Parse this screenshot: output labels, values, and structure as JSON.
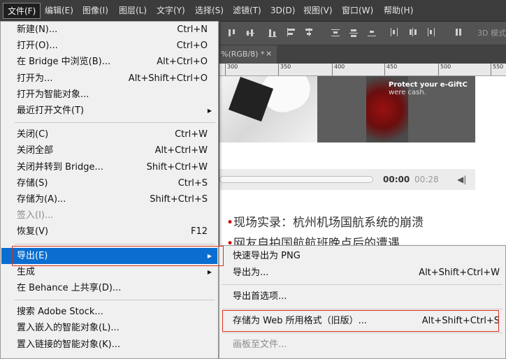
{
  "menubar": {
    "items": [
      "文件(F)",
      "编辑(E)",
      "图像(I)",
      "图层(L)",
      "文字(Y)",
      "选择(S)",
      "滤镜(T)",
      "3D(D)",
      "视图(V)",
      "窗口(W)",
      "帮助(H)"
    ]
  },
  "options_bar": {
    "mode_3d": "3D 模式"
  },
  "document": {
    "tab_title": "%(RGB/8) *",
    "close": "×",
    "ruler_ticks": [
      "300",
      "350",
      "400",
      "450",
      "500",
      "550"
    ]
  },
  "canvas": {
    "promo_line1": "Protect your e-GiftC",
    "promo_line2": "were cash.",
    "time_current": "00:00",
    "time_total": "00:28",
    "volume_icon": "◀|",
    "news1": "现场实录：杭州机场国航系统的崩溃",
    "news2": "网友自拍国航航班晚点后的遭遇",
    "bullet": "•"
  },
  "file_menu": {
    "groups": [
      [
        {
          "label": "新建(N)...",
          "shortcut": "Ctrl+N"
        },
        {
          "label": "打开(O)...",
          "shortcut": "Ctrl+O"
        },
        {
          "label": "在 Bridge 中浏览(B)...",
          "shortcut": "Alt+Ctrl+O"
        },
        {
          "label": "打开为...",
          "shortcut": "Alt+Shift+Ctrl+O"
        },
        {
          "label": "打开为智能对象...",
          "shortcut": ""
        },
        {
          "label": "最近打开文件(T)",
          "shortcut": "",
          "submenu": true
        }
      ],
      [
        {
          "label": "关闭(C)",
          "shortcut": "Ctrl+W"
        },
        {
          "label": "关闭全部",
          "shortcut": "Alt+Ctrl+W"
        },
        {
          "label": "关闭并转到 Bridge...",
          "shortcut": "Shift+Ctrl+W"
        },
        {
          "label": "存储(S)",
          "shortcut": "Ctrl+S"
        },
        {
          "label": "存储为(A)...",
          "shortcut": "Shift+Ctrl+S"
        },
        {
          "label": "签入(I)...",
          "shortcut": "",
          "disabled": true
        },
        {
          "label": "恢复(V)",
          "shortcut": "F12"
        }
      ],
      [
        {
          "label": "导出(E)",
          "shortcut": "",
          "submenu": true,
          "highlighted": true
        },
        {
          "label": "生成",
          "shortcut": "",
          "submenu": true
        },
        {
          "label": "在 Behance 上共享(D)...",
          "shortcut": ""
        }
      ],
      [
        {
          "label": "搜索 Adobe Stock...",
          "shortcut": ""
        },
        {
          "label": "置入嵌入的智能对象(L)...",
          "shortcut": ""
        },
        {
          "label": "置入链接的智能对象(K)...",
          "shortcut": ""
        }
      ]
    ]
  },
  "export_submenu": {
    "groups": [
      [
        {
          "label": "快速导出为 PNG",
          "shortcut": ""
        },
        {
          "label": "导出为...",
          "shortcut": "Alt+Shift+Ctrl+W"
        }
      ],
      [
        {
          "label": "导出首选项...",
          "shortcut": ""
        }
      ],
      [
        {
          "label": "存储为 Web 所用格式（旧版）...",
          "shortcut": "Alt+Shift+Ctrl+S"
        }
      ],
      [
        {
          "label": "画板至文件...",
          "shortcut": "",
          "disabled": true
        }
      ]
    ]
  },
  "colors": {
    "menu_bg": "#f0f0f0",
    "highlight": "#0a6ed1",
    "annotation_red": "#e0301e",
    "menubar_bg": "#3c3c3c"
  }
}
